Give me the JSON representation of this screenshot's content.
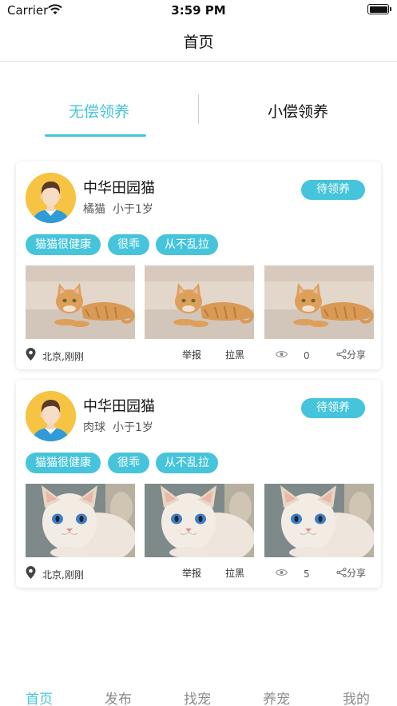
{
  "status_bar": {
    "carrier": "Carrier",
    "time": "3:59 PM"
  },
  "nav": {
    "title": "首页"
  },
  "segments": [
    {
      "label": "无偿领养",
      "selected": true
    },
    {
      "label": "小偿领养",
      "selected": false
    }
  ],
  "colors": {
    "accent": "#45c4db",
    "avatar_bg": "#f6c342"
  },
  "posts": [
    {
      "name": "中华田园猫",
      "breed": "橘猫",
      "age": "小于1岁",
      "status": "待领养",
      "tags": [
        "猫猫很健康",
        "很乖",
        "从不乱拉"
      ],
      "photo_subject": "orange-tabby-cat",
      "location": "北京,刚刚",
      "report": "举报",
      "block": "拉黑",
      "views": "0",
      "share": "分享"
    },
    {
      "name": "中华田园猫",
      "breed": "肉球",
      "age": "小于1岁",
      "status": "待领养",
      "tags": [
        "猫猫很健康",
        "很乖",
        "从不乱拉"
      ],
      "photo_subject": "cream-british-shorthair-cat",
      "location": "北京,刚刚",
      "report": "举报",
      "block": "拉黑",
      "views": "5",
      "share": "分享"
    }
  ],
  "tab_bar": [
    {
      "label": "首页",
      "selected": true
    },
    {
      "label": "发布",
      "selected": false
    },
    {
      "label": "找宠",
      "selected": false
    },
    {
      "label": "养宠",
      "selected": false
    },
    {
      "label": "我的",
      "selected": false
    }
  ]
}
